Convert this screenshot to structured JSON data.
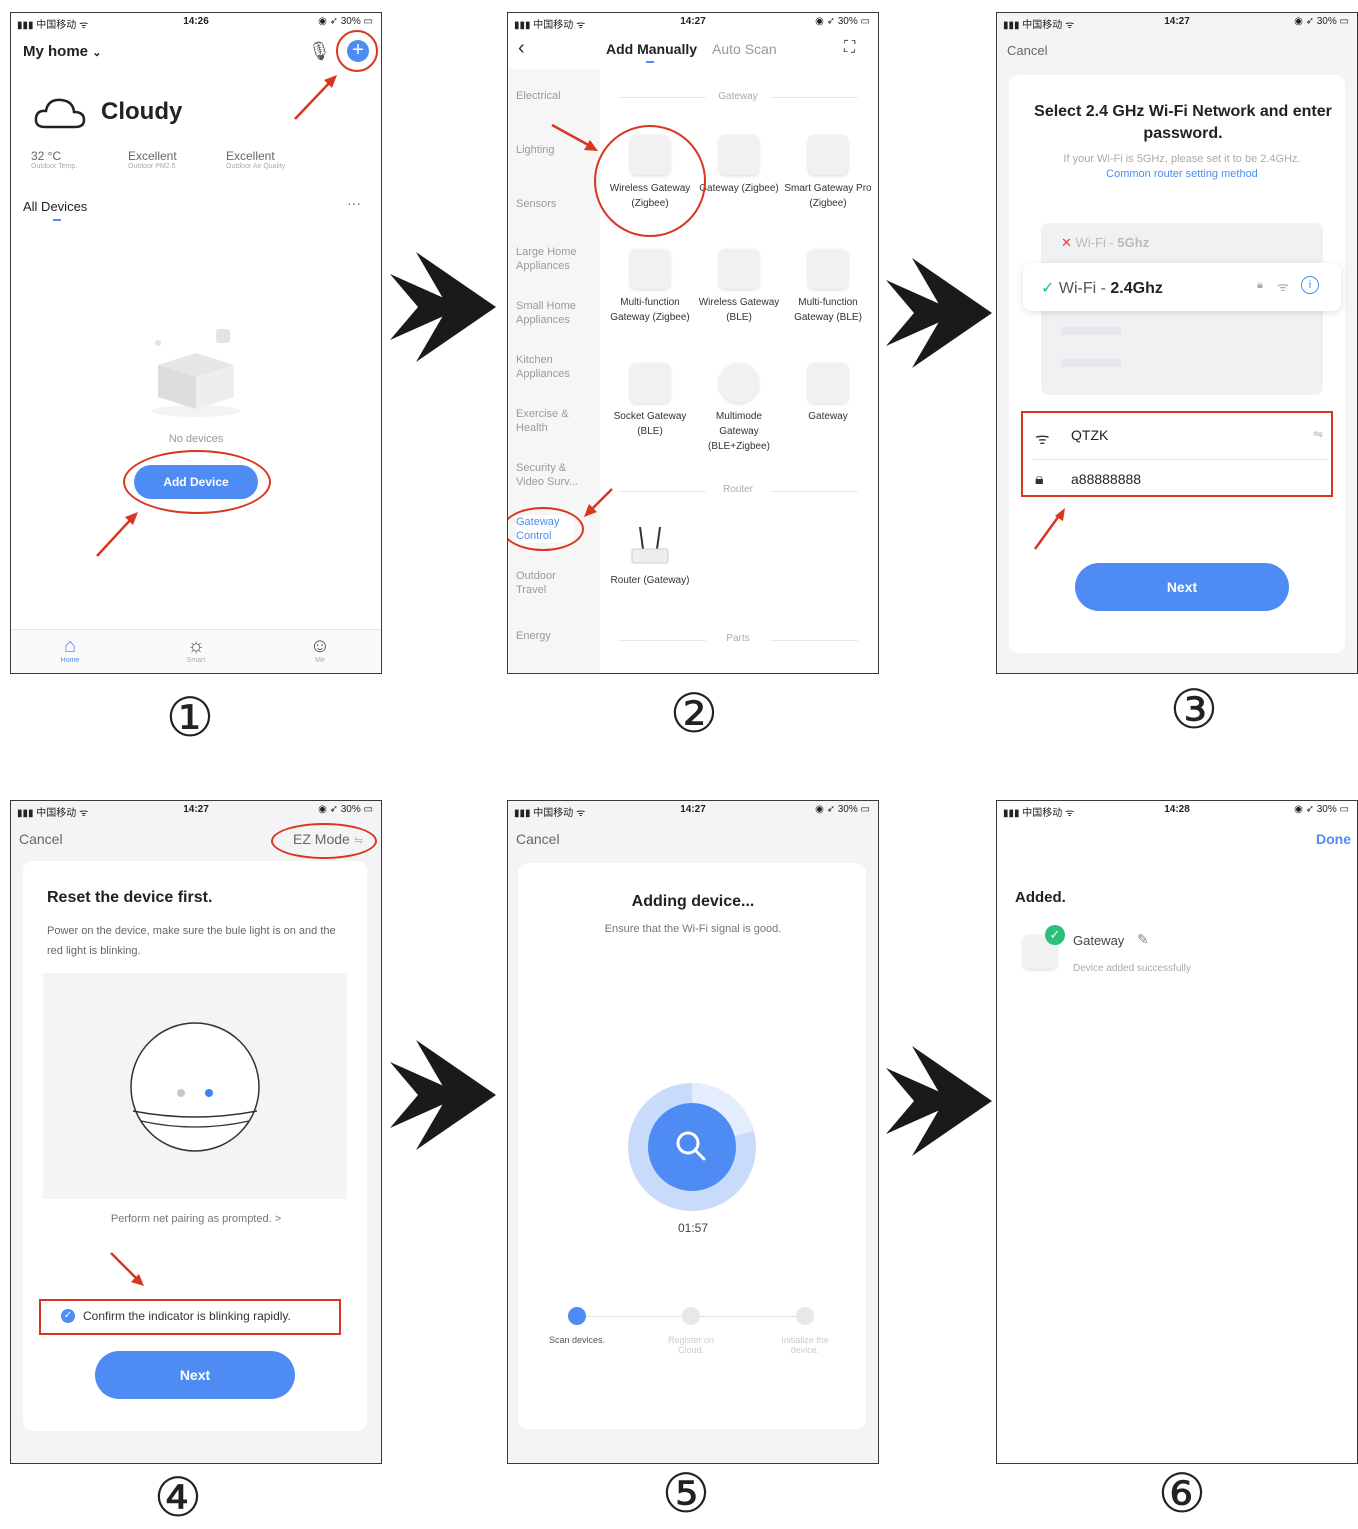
{
  "status": {
    "carrier": "中国移动",
    "battery": "30%",
    "times": [
      "14:26",
      "14:27",
      "14:27",
      "14:27",
      "14:27",
      "14:28"
    ]
  },
  "step_numbers": [
    "①",
    "②",
    "③",
    "④",
    "⑤",
    "⑥"
  ],
  "screen1": {
    "home_title": "My home",
    "weather": "Cloudy",
    "stats": [
      {
        "value": "32 °C",
        "label": "Outdoor Temp."
      },
      {
        "value": "Excellent",
        "label": "Outdoor PM2.5"
      },
      {
        "value": "Excellent",
        "label": "Outdoor Air Quality"
      }
    ],
    "all_devices": "All Devices",
    "no_devices": "No devices",
    "add_device": "Add Device",
    "tabs": [
      "Home",
      "Smart",
      "Me"
    ]
  },
  "screen2": {
    "tab_manual": "Add Manually",
    "tab_auto": "Auto Scan",
    "categories": [
      "Electrical",
      "Lighting",
      "Sensors",
      "Large Home Appliances",
      "Small Home Appliances",
      "Kitchen Appliances",
      "Exercise & Health",
      "Security & Video Surv...",
      "Gateway Control",
      "Outdoor Travel",
      "Energy"
    ],
    "section_gateway": "Gateway",
    "section_router": "Router",
    "section_parts": "Parts",
    "devices": [
      "Wireless Gateway (Zigbee)",
      "Gateway (Zigbee)",
      "Smart Gateway Pro (Zigbee)",
      "Multi-function Gateway (Zigbee)",
      "Wireless Gateway (BLE)",
      "Multi-function Gateway (BLE)",
      "Socket Gateway (BLE)",
      "Multimode Gateway (BLE+Zigbee)",
      "Gateway"
    ],
    "router": "Router (Gateway)"
  },
  "screen3": {
    "cancel": "Cancel",
    "title": "Select 2.4 GHz Wi-Fi Network and enter password.",
    "hint": "If your Wi-Fi is 5GHz, please set it to be 2.4GHz.",
    "link": "Common router setting method",
    "wifi_5g_prefix": "Wi-Fi - ",
    "wifi_5g": "5Ghz",
    "wifi_24_prefix": "Wi-Fi - ",
    "wifi_24": "2.4Ghz",
    "ssid": "QTZK",
    "password": "a88888888",
    "next": "Next"
  },
  "screen4": {
    "cancel": "Cancel",
    "mode": "EZ Mode",
    "title": "Reset the device first.",
    "desc": "Power on the device, make sure the bule light is on and the red light is blinking.",
    "prompt": "Perform net pairing as prompted. >",
    "confirm": "Confirm the indicator is blinking rapidly.",
    "next": "Next"
  },
  "screen5": {
    "cancel": "Cancel",
    "title": "Adding device...",
    "subtitle": "Ensure that the Wi-Fi signal is good.",
    "timer": "01:57",
    "steps": [
      "Scan devices.",
      "Register on Cloud.",
      "Initialize the device."
    ]
  },
  "screen6": {
    "done": "Done",
    "added": "Added.",
    "device_name": "Gateway",
    "device_status": "Device added successfully"
  },
  "colors": {
    "accent": "#4e8cf3",
    "annotation": "#d8361f",
    "success": "#2bbf7a"
  }
}
